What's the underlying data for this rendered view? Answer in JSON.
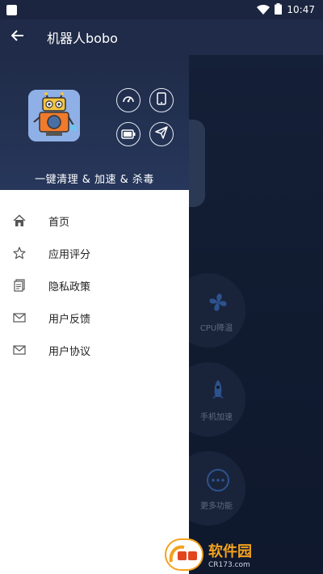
{
  "status_bar": {
    "time": "10:47",
    "wifi_icon": "wifi-icon",
    "battery_icon": "battery-icon"
  },
  "app_bar": {
    "back_icon": "back-arrow-icon",
    "title": "机器人bobo"
  },
  "drawer": {
    "header": {
      "app_icon": "robot-app-icon",
      "quick_actions": [
        {
          "icon": "speedometer-icon"
        },
        {
          "icon": "phone-icon"
        },
        {
          "icon": "battery-icon"
        },
        {
          "icon": "send-icon"
        }
      ],
      "tagline": "一键清理 & 加速 & 杀毒"
    },
    "menu": [
      {
        "icon": "home-icon",
        "label": "首页"
      },
      {
        "icon": "star-icon",
        "label": "应用评分"
      },
      {
        "icon": "document-icon",
        "label": "隐私政策"
      },
      {
        "icon": "mail-icon",
        "label": "用户反馈"
      },
      {
        "icon": "mail-icon",
        "label": "用户协议"
      }
    ]
  },
  "background": {
    "tiles": [
      {
        "icon": "fan-icon",
        "label": "CPU降温"
      },
      {
        "icon": "rocket-icon",
        "label": "手机加速"
      },
      {
        "icon": "more-icon",
        "label": "更多功能"
      }
    ]
  },
  "watermark": {
    "title": "软件园",
    "site": "CR173.com",
    "colors": {
      "orange": "#f4a21e",
      "red": "#e2461f"
    }
  }
}
